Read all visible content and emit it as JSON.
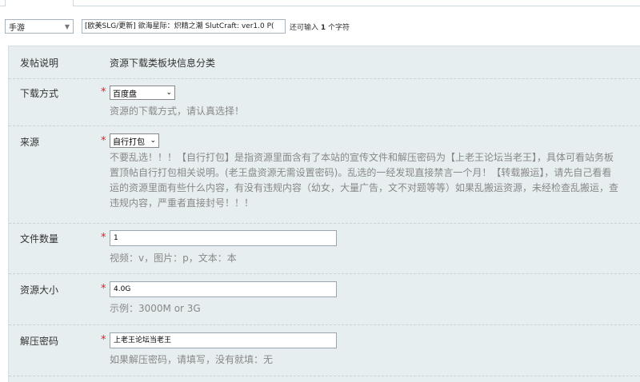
{
  "top": {
    "category_value": "手游",
    "title_value": "[欧美SLG/更新] 欲海星际：炽精之潮 SlutCraft: ver1.0 P(",
    "char_hint_prefix": "还可输入",
    "char_hint_count": "1",
    "char_hint_suffix": "个字符"
  },
  "form": {
    "post_desc": {
      "label": "发帖说明",
      "text": "资源下载类板块信息分类"
    },
    "download_method": {
      "label": "下载方式",
      "value": "百度盘",
      "hint": "资源的下载方式，请认真选择！"
    },
    "source": {
      "label": "来源",
      "value": "自行打包",
      "hint_lines": [
        "不要乱选！！！【自行打包】是指资源里面含有了本站的宣传文件和解压密码为【上老王论坛当老王】，具体可看站务板",
        "置顶帖自行打包相关说明。(老王盘资源无需设置密码)。乱选的一经发现直接禁言一个月！【转载搬运】，请先自己看看",
        "运的资源里面有些什么内容，有没有违规内容（幼女，大量广告，文不对题等等）如果乱搬运资源，未经检查乱搬运，查",
        "违规内容，严重者直接封号！！！"
      ]
    },
    "file_count": {
      "label": "文件数量",
      "value": "1",
      "hint": "视频：v，图片：p，文本：本"
    },
    "resource_size": {
      "label": "资源大小",
      "value": "4.0G",
      "hint": "示例：3000M or 3G"
    },
    "unzip_password": {
      "label": "解压密码",
      "value": "上老王论坛当老王",
      "hint": "如果解压密码，请填写，没有就填：无"
    },
    "required_mark": "*"
  }
}
